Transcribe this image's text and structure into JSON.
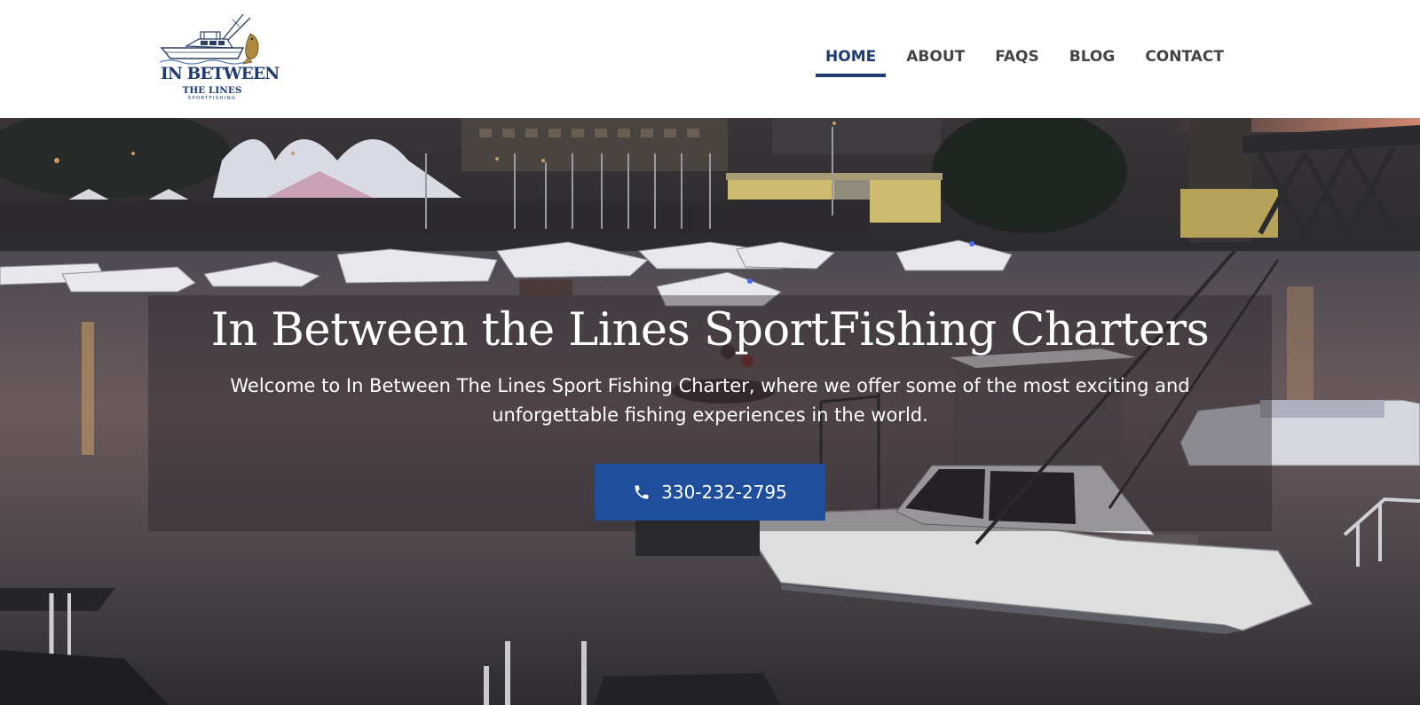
{
  "header": {
    "logo": {
      "line1": "IN BETWEEN",
      "line2": "THE LINES",
      "line3": "SPORTFISHING"
    },
    "nav": [
      {
        "label": "HOME",
        "active": true
      },
      {
        "label": "ABOUT",
        "active": false
      },
      {
        "label": "FAQS",
        "active": false
      },
      {
        "label": "BLOG",
        "active": false
      },
      {
        "label": "CONTACT",
        "active": false
      }
    ]
  },
  "hero": {
    "title": "In Between the Lines SportFishing Charters",
    "description": "Welcome to In Between The Lines Sport Fishing Charter, where we offer some of the most exciting and unforgettable fishing experiences in the world.",
    "call_button": {
      "icon": "phone-icon",
      "label": "330-232-2795"
    },
    "background": "harbor-at-dusk-photo"
  },
  "colors": {
    "brand_navy": "#1f3b73",
    "button_blue": "#1f4e9c",
    "nav_text": "#444444",
    "white": "#ffffff"
  }
}
